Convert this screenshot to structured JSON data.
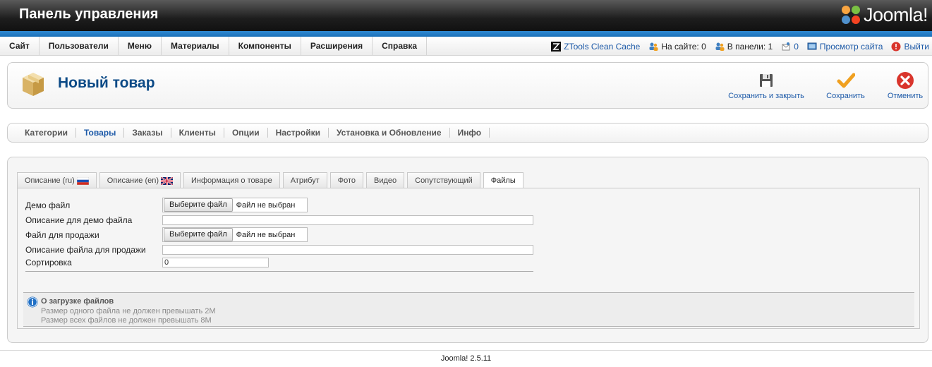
{
  "header": {
    "title": "Панель управления",
    "brand": "Joomla!"
  },
  "menu": {
    "items": [
      "Сайт",
      "Пользователи",
      "Меню",
      "Материалы",
      "Компоненты",
      "Расширения",
      "Справка"
    ],
    "right": {
      "clean_cache": "ZTools Clean Cache",
      "on_site": "На сайте: 0",
      "in_panel": "В панели: 1",
      "messages": "0",
      "view_site": "Просмотр сайта",
      "logout": "Выйти"
    }
  },
  "toolbar": {
    "title": "Новый товар",
    "save_close": "Сохранить и закрыть",
    "save": "Сохранить",
    "cancel": "Отменить"
  },
  "submenu": {
    "items": [
      "Категории",
      "Товары",
      "Заказы",
      "Клиенты",
      "Опции",
      "Настройки",
      "Установка и Обновление",
      "Инфо"
    ],
    "active": "Товары"
  },
  "tabs": {
    "items": [
      "Описание (ru)",
      "Описание (en)",
      "Информация о товаре",
      "Атрибут",
      "Фото",
      "Видео",
      "Сопутствующий",
      "Файлы"
    ],
    "active": "Файлы"
  },
  "form": {
    "demo_file_label": "Демо файл",
    "demo_desc_label": "Описание для демо файла",
    "sale_file_label": "Файл для продажи",
    "sale_desc_label": "Описание файла для продажи",
    "sort_label": "Сортировка",
    "choose_file_button": "Выберите файл",
    "no_file_text": "Файл не выбран",
    "sort_value": "0",
    "demo_desc_value": "",
    "sale_desc_value": ""
  },
  "info": {
    "title": "О загрузке файлов",
    "line1": "Размер одного файла не должен превышать 2M",
    "line2": "Размер всех файлов не должен превышать 8M"
  },
  "footer": {
    "version": "Joomla! 2.5.11"
  },
  "colors": {
    "accent": "#1d5aa8",
    "title": "#0c4a86",
    "header_dark": "#111111",
    "blue_bar": "#2f8ad4",
    "save_check": "#f0a020",
    "cancel_red": "#d9352c"
  }
}
